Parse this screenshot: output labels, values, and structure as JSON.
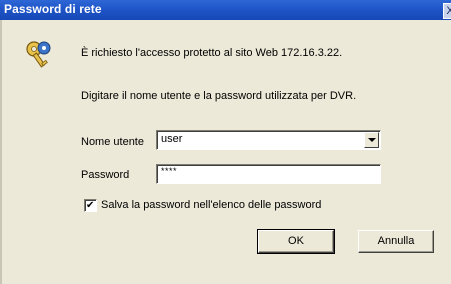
{
  "window": {
    "title": "Password di rete",
    "close_label": "X"
  },
  "message": {
    "line1": "È richiesto l'accesso protetto al sito Web 172.16.3.22.",
    "line2": "Digitare il nome utente e la password utilizzata per DVR."
  },
  "form": {
    "username_label": "Nome utente",
    "username_value": "user",
    "password_label": "Password",
    "password_value": "****",
    "save_checkbox_checked": true,
    "save_checkbox_mark": "✔",
    "save_label": "Salva la password nell'elenco delle password"
  },
  "buttons": {
    "ok": "OK",
    "cancel": "Annulla"
  },
  "icons": {
    "key": "key-icon",
    "dropdown": "chevron-down-icon"
  },
  "colors": {
    "titlebar": "#1f55c8",
    "dialog_bg": "#ece9d8"
  }
}
